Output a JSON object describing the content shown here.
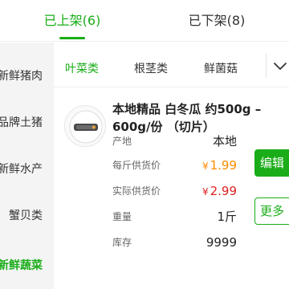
{
  "top_tabs": [
    {
      "label": "已上架(6)",
      "active": true
    },
    {
      "label": "已下架(8)",
      "active": false
    }
  ],
  "sidebar": {
    "items": [
      {
        "label": "新鲜猪肉",
        "active": false
      },
      {
        "label": "品牌土猪",
        "active": false
      },
      {
        "label": "新鲜水产",
        "active": false
      },
      {
        "label": "蟹贝类",
        "active": false
      },
      {
        "label": "新鲜蔬菜",
        "active": true
      }
    ]
  },
  "categories": {
    "items": [
      {
        "label": "叶菜类",
        "active": true
      },
      {
        "label": "根茎类",
        "active": false
      },
      {
        "label": "鲜菌菇",
        "active": false
      }
    ],
    "more_icon": "chevron-down-icon"
  },
  "product": {
    "image_icon": "product-thumbnail",
    "title_line1": "本地精品 白冬瓜 约500g –",
    "title_line2": "600g/份 （切片）",
    "fields": [
      {
        "label": "产地",
        "value": "本地"
      },
      {
        "label": "每斤供货价",
        "currency": "¥",
        "value": "1.99"
      },
      {
        "label": "实际供货价",
        "currency": "¥",
        "value": "2.99"
      },
      {
        "label": "重量",
        "value": "1斤"
      },
      {
        "label": "库存",
        "value": "9999"
      }
    ],
    "edit_label": "编辑",
    "more_label": "更多"
  },
  "colors": {
    "accent": "#1aad19",
    "price_orange": "#ff8a00",
    "price_red": "#e02020"
  }
}
